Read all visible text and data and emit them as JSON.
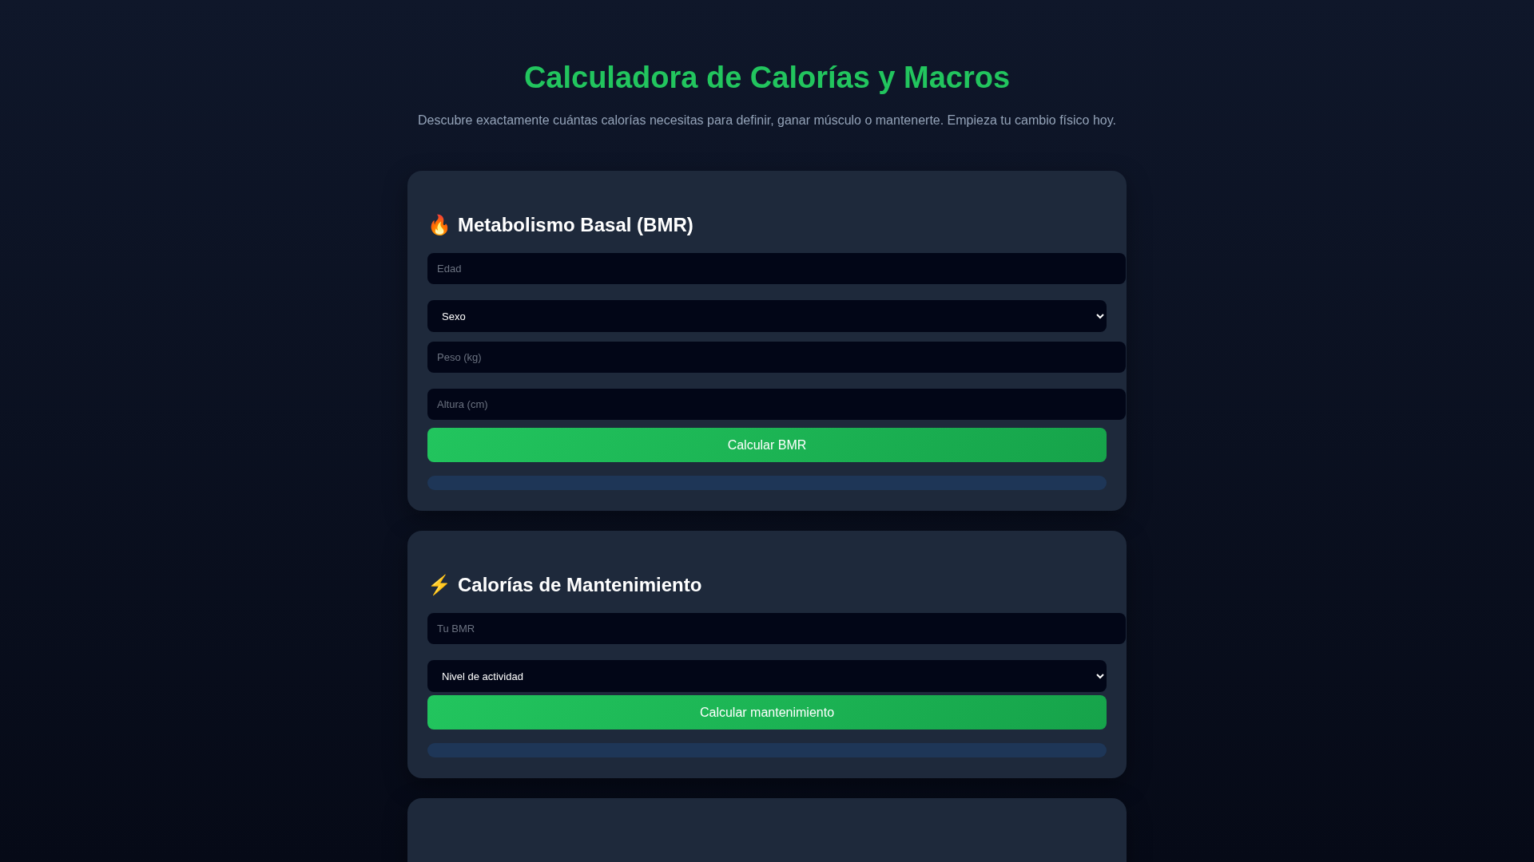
{
  "header": {
    "title": "Calculadora de Calorías y Macros",
    "subtitle": "Descubre exactamente cuántas calorías necesitas para definir, ganar músculo o mantenerte. Empieza tu cambio físico hoy."
  },
  "cards": [
    {
      "icon": "🔥",
      "title": "Metabolismo Basal (BMR)",
      "fields": [
        {
          "kind": "input",
          "placeholder": "Edad"
        },
        {
          "kind": "select",
          "value": "Sexo"
        },
        {
          "kind": "input",
          "placeholder": "Peso (kg)"
        },
        {
          "kind": "input",
          "placeholder": "Altura (cm)"
        }
      ],
      "button": "Calcular BMR"
    },
    {
      "icon": "⚡",
      "title": "Calorías de Mantenimiento",
      "fields": [
        {
          "kind": "input",
          "placeholder": "Tu BMR"
        },
        {
          "kind": "select",
          "value": "Nivel de actividad"
        }
      ],
      "button": "Calcular mantenimiento"
    }
  ]
}
